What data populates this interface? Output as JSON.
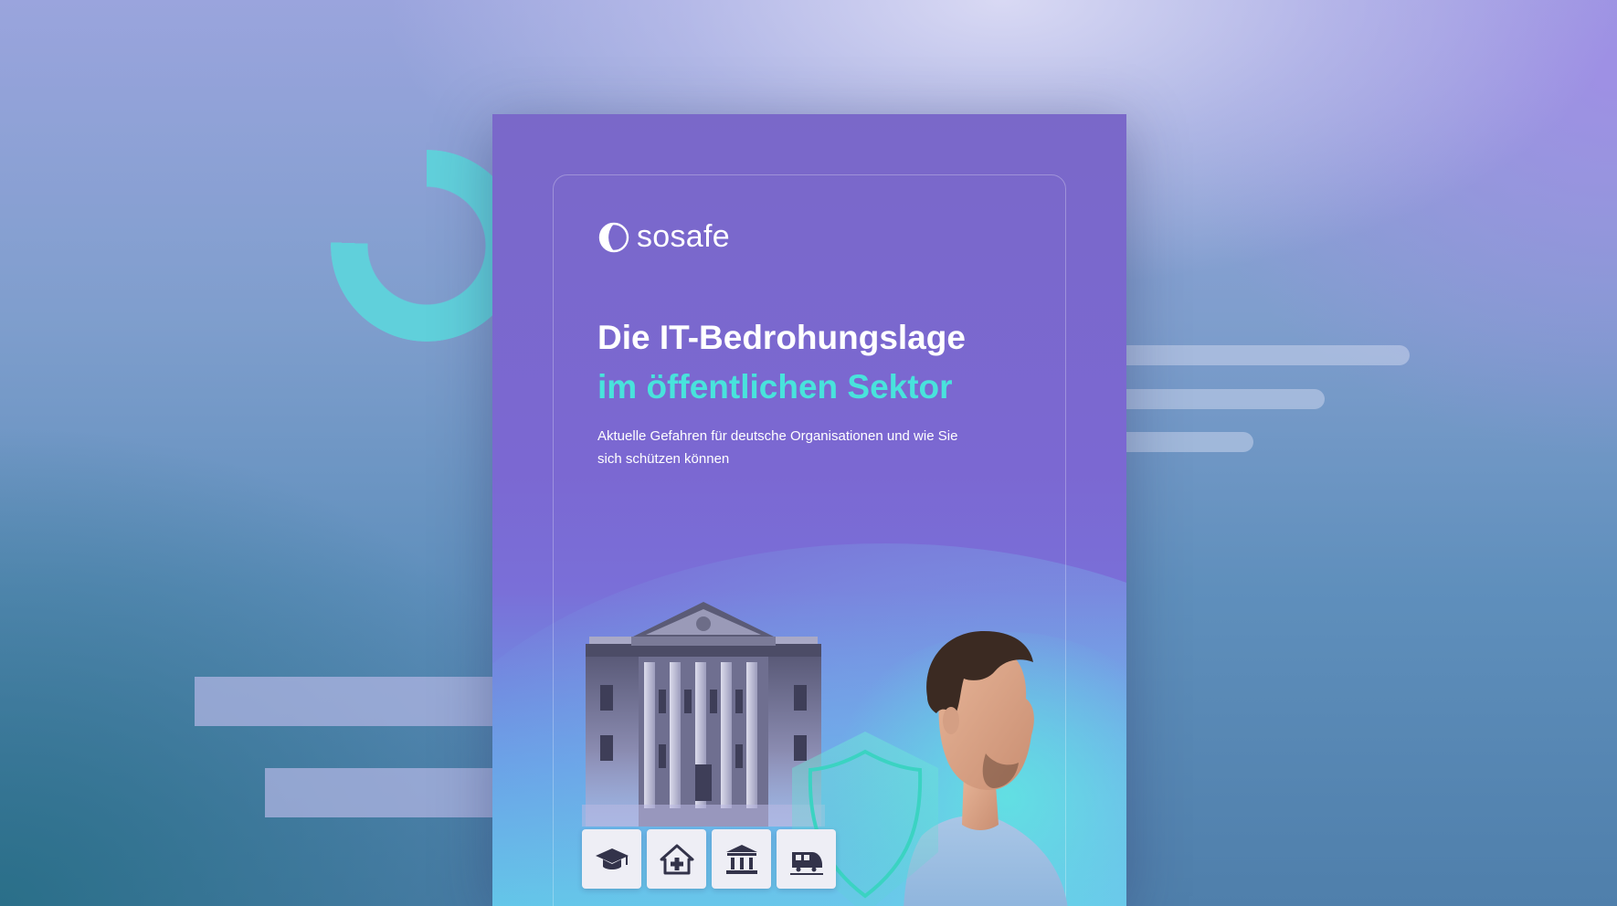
{
  "brand": {
    "name": "sosafe",
    "accent_color": "#48e3dc",
    "primary_color": "#7a68c9"
  },
  "cover": {
    "title_line1": "Die IT-Bedrohungslage",
    "title_line2": "im öffentlichen Sektor",
    "subtitle": "Aktuelle Gefahren für deutsche Organisationen und wie Sie sich schützen können"
  },
  "sector_icons": [
    {
      "icon": "graduation-cap-icon"
    },
    {
      "icon": "home-health-icon"
    },
    {
      "icon": "government-building-icon"
    },
    {
      "icon": "train-icon"
    }
  ],
  "decor": {
    "ring_color": "#5fd3dc"
  }
}
